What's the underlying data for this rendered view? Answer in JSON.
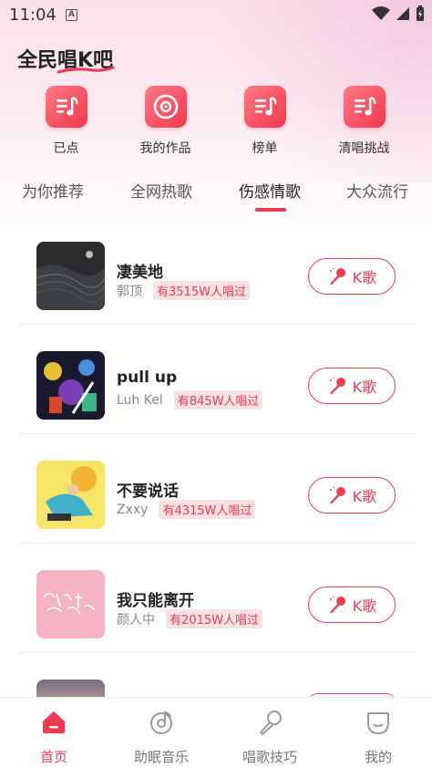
{
  "status_bar": {
    "time": "11:04",
    "indicator": "A"
  },
  "app": {
    "title": "全民唱K吧",
    "accent_color": "#ee3b52"
  },
  "quick_actions": [
    {
      "label": "已点",
      "icon": "music-list-icon"
    },
    {
      "label": "我的作品",
      "icon": "record-disc-icon"
    },
    {
      "label": "榜单",
      "icon": "music-list-icon"
    },
    {
      "label": "清唱挑战",
      "icon": "music-list-icon"
    }
  ],
  "tabs": [
    {
      "label": "为你推荐",
      "active": false
    },
    {
      "label": "全网热歌",
      "active": false
    },
    {
      "label": "伤感情歌",
      "active": true
    },
    {
      "label": "大众流行",
      "active": false
    }
  ],
  "songs": [
    {
      "title": "凄美地",
      "artist": "郭顶",
      "sung_count": "有3515W人唱过",
      "button": "K歌"
    },
    {
      "title": "pull up",
      "artist": "Luh Kel",
      "sung_count": "有845W人唱过",
      "button": "K歌"
    },
    {
      "title": "不要说话",
      "artist": "Zxxy",
      "sung_count": "有4315W人唱过",
      "button": "K歌"
    },
    {
      "title": "我只能离开",
      "artist": "颜人中",
      "sung_count": "有2015W人唱过",
      "button": "K歌"
    }
  ],
  "bottom_nav": [
    {
      "label": "首页",
      "active": true,
      "icon": "home-icon"
    },
    {
      "label": "助眠音乐",
      "active": false,
      "icon": "music-note-disc-icon"
    },
    {
      "label": "唱歌技巧",
      "active": false,
      "icon": "microphone-icon"
    },
    {
      "label": "我的",
      "active": false,
      "icon": "profile-icon"
    }
  ]
}
